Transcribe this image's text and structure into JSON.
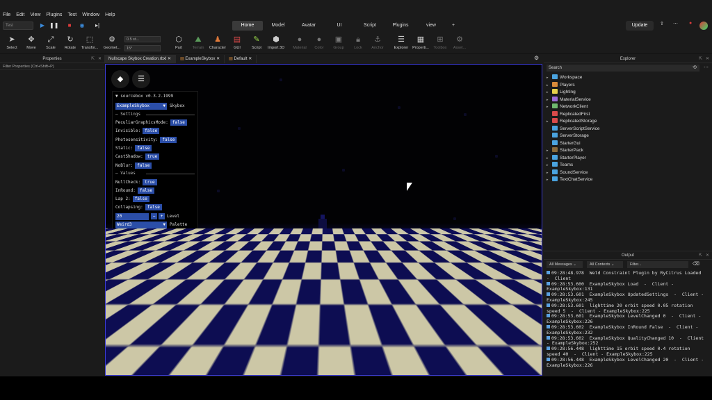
{
  "menu": [
    "File",
    "Edit",
    "View",
    "Plugins",
    "Test",
    "Window",
    "Help"
  ],
  "controls": {
    "test_mode": "Test"
  },
  "ribbon_tabs": [
    "Home",
    "Model",
    "Avatar",
    "UI",
    "Script",
    "Plugins",
    "view"
  ],
  "active_tab": "Home",
  "update_label": "Update",
  "tools": [
    "Select",
    "Move",
    "Scale",
    "Rotate",
    "Transfor...",
    "Geomet...",
    "Part",
    "Terrain",
    "Character",
    "GUI",
    "Script",
    "Import 3D",
    "Material",
    "Color",
    "Group",
    "Lock",
    "Anchor",
    "Explorer",
    "Properti...",
    "Toolbox",
    "Asset..."
  ],
  "snap": {
    "move": "0.5 st...",
    "rotate": "15°"
  },
  "properties": {
    "title": "Properties",
    "filter": "Filter Properties (Ctrl+Shift+P)"
  },
  "doc_tabs": [
    "Nullscape Skybox Creation.rbxl",
    "ExampleSkybox",
    "Default"
  ],
  "sourcebox": {
    "title": "sourcebox v0.3.2.1999",
    "skybox_select": "ExampleSkybox",
    "skybox_label": "Skybox",
    "settings_header": "Settings",
    "settings": [
      {
        "label": "PeculiarGraphicsMode:",
        "value": "false"
      },
      {
        "label": "Invisible:",
        "value": "false"
      },
      {
        "label": "Photosensitivity:",
        "value": "false"
      },
      {
        "label": "Static:",
        "value": "false"
      },
      {
        "label": "CastShadow:",
        "value": "true"
      },
      {
        "label": "NoBlur:",
        "value": "false"
      }
    ],
    "values_header": "Values",
    "values": [
      {
        "label": "NullCheck:",
        "value": "true"
      },
      {
        "label": "InRound:",
        "value": "false"
      },
      {
        "label": "Lap 2:",
        "value": "false"
      },
      {
        "label": "Collapsing:",
        "value": "false"
      }
    ],
    "level_value": "20",
    "level_label": "Level",
    "palette_select": "Weird3",
    "palette_label": "Palette"
  },
  "explorer": {
    "title": "Explorer",
    "search_placeholder": "Search",
    "items": [
      {
        "label": "Workspace",
        "color": "#4aa3df"
      },
      {
        "label": "Players",
        "color": "#d98b3a"
      },
      {
        "label": "Lighting",
        "color": "#e6d04a"
      },
      {
        "label": "MaterialService",
        "color": "#9b6ad6"
      },
      {
        "label": "NetworkClient",
        "color": "#6fb86f"
      },
      {
        "label": "ReplicatedFirst",
        "color": "#d94a4a"
      },
      {
        "label": "ReplicatedStorage",
        "color": "#d94a4a"
      },
      {
        "label": "ServerScriptService",
        "color": "#4aa3df"
      },
      {
        "label": "ServerStorage",
        "color": "#4aa3df"
      },
      {
        "label": "StarterGui",
        "color": "#4aa3df"
      },
      {
        "label": "StarterPack",
        "color": "#8a6a3a"
      },
      {
        "label": "StarterPlayer",
        "color": "#4aa3df"
      },
      {
        "label": "Teams",
        "color": "#4aa3df"
      },
      {
        "label": "SoundService",
        "color": "#4aa3df"
      },
      {
        "label": "TextChatService",
        "color": "#4aa3df"
      }
    ]
  },
  "output": {
    "title": "Output",
    "filter_messages": "All Messages",
    "filter_contexts": "All Contexts",
    "filter_placeholder": "Filter...",
    "lines": [
      "09:28:48.978  Weld Constraint Plugin by RyCitrus Loaded  -  Client",
      "09:28:53.600  ExampleSkybox Load  -  Client - ExampleSkybox:131",
      "09:28:53.601  ExampleSkybox UpdatedSettings  -  Client - ExampleSkybox:245",
      "09:28:53.601  lighttime 20 orbit speed 0.05 rotation speed 5  -  Client - ExampleSkybox:225",
      "09:28:53.601  ExampleSkybox LevelChanged 0  -  Client - ExampleSkybox:226",
      "09:28:53.602  ExampleSkybox InRound False  -  Client - ExampleSkybox:232",
      "09:28:53.602  ExampleSkybox QualityChanged 10  -  Client - ExampleSkybox:252",
      "09:28:56.448  lighttime 15 orbit speed 0.4 rotation speed 40  -  Client - ExampleSkybox:225",
      "09:28:56.448  ExampleSkybox LevelChanged 20  -  Client - ExampleSkybox:226"
    ]
  }
}
